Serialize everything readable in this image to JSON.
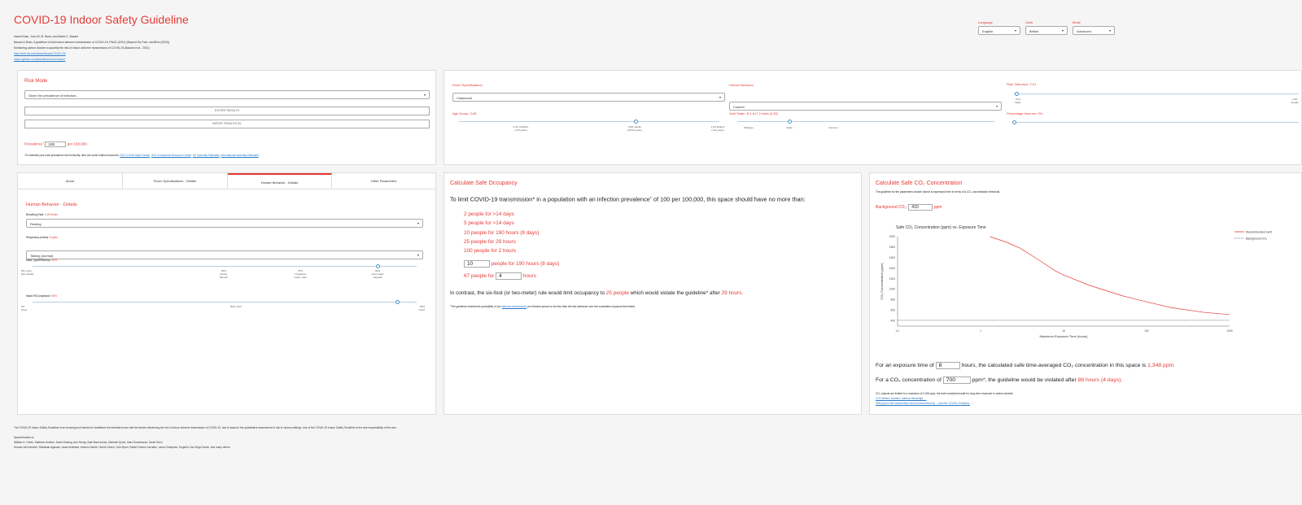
{
  "app": {
    "title": "COVID-19 Indoor Safety Guideline",
    "authors": "Kasim Khan, John W. M. Bush, and Martin Z. Bazant",
    "ref1": "Bazant & Bush, A guideline to limit indoor airborne transmission of COVID-19, PNAS (2021) (Beyond Six Feet, medRxiv (2020))",
    "ref2": "Monitoring carbon dioxide to quantify the risk of indoor airborne transmission of COVID-19 (Bazant et al., 2021)",
    "link1": "http://web.mit.edu/bazant/www/COVID-19/",
    "link2": "https://github.com/kasimkhan/covid-indoor"
  },
  "top_selects": {
    "language": {
      "label": "Language",
      "value": "English"
    },
    "units": {
      "label": "Units",
      "value": "British"
    },
    "mode": {
      "label": "Mode",
      "value": "Advanced"
    }
  },
  "risk_mode": {
    "heading": "Risk Mode",
    "select_value": "Given the prevalence of infection...",
    "export_label": "EXPORT RESULTS",
    "import_label": "IMPORT FROM EXCEL",
    "prevalence_label": "Prevalence",
    "prevalence_value": "100",
    "prevalence_unit": "per 100,000",
    "footnote_prefix": "¹To estimate your local prevalence and immunity, here are some helpful resources:",
    "resources": [
      "CDC COVID Data Tracker",
      "JHU Coronavirus Resource Center",
      "US Immunity Estimates",
      "International Immunity Estimates"
    ]
  },
  "settings": {
    "room_label": "Room Specifications:",
    "room_value": "Classroom",
    "behavior_label": "Human Behavior:",
    "behavior_value": "Custom",
    "risk_label": "Risk Tolerance: 0.01",
    "risk_marks": [
      "0.01\nSafer",
      "1.00\nUnsafe"
    ],
    "risk_level": 0.01,
    "age_label": "Age Group: 0.68",
    "age_marks": [
      "0.23: Children\n(<15 years)",
      "0.68: Adults\n(15-64 years)",
      "1.00: Elderly\n(>64 years)"
    ],
    "age_level": 0.68,
    "strain_label": "Viral Strain: B.1.617.2 India (2.50)",
    "strain_marks": [
      "Wildtype",
      "Delta",
      "Omicron"
    ],
    "immune_label": "Percentage Immune: 0%",
    "immune_level": 0
  },
  "tabs": [
    "About",
    "Room Specifications - Details",
    "Human Behavior - Details",
    "Other Parameters"
  ],
  "behavior_details": {
    "heading": "Human Behavior - Details",
    "breathing_label": "Breathing Rate:",
    "breathing_value": "0.29 ft³/min",
    "breathing_select": "Resting",
    "resp_label": "Respiratory Activity:",
    "resp_value": "5 (q/ft³)",
    "resp_select": "Talking (normal)",
    "mask_label": "Mask Type/Efficiency:",
    "mask_value": "90%",
    "mask_marks": [
      "0% (none,\nface shield)",
      "50%\n(cotton,\nflannel)",
      "75%\n(3-layered\ncotton, silk)",
      "90%\n(chg mask/\nsurgical)"
    ],
    "mask_level": 0.9,
    "fit_label": "Mask Fit/Compliance:",
    "fit_value": "95%",
    "fit_marks": [
      "0%\nNone",
      "50%: Poor",
      "95%\nGood"
    ],
    "fit_level": 0.95
  },
  "occupancy": {
    "heading": "Calculate Safe Occupancy",
    "intro_a": "To limit COVID-19 transmission* in a population with an infection prevalence",
    "intro_b": " of 100 per 100,000, this space should have no more than:",
    "lines": [
      "2 people for >14 days",
      "5 people for >14 days",
      "10 people for 190 hours (8 days)",
      "25 people for 29 hours",
      "100 people for 2 hours"
    ],
    "custom_people": "10",
    "custom_people_suffix": "people for 190 hours (8 days)",
    "custom_hours_prefix": "67 people for",
    "custom_hours": "4",
    "custom_hours_suffix": "hours",
    "contrast_a": "In contrast, the six-foot (or two-meter) rule would limit occupancy to ",
    "contrast_people": "25 people",
    "contrast_b": " which would violate the guideline* after ",
    "contrast_hours": "29 hours.",
    "note_a": "*The guideline restricts the probability of one ",
    "note_link": "airborne transmission",
    "note_b": " per infected person to be less than the risk tolerance over the cumulative exposure time listed."
  },
  "co2": {
    "heading": "Calculate Safe CO₂ Concentration",
    "sub": "The guideline for the parameters chosen above is expressed here in terms of a CO₂ concentration threshold.",
    "bg_label": "Background CO₂:",
    "bg_value": "410",
    "bg_unit": "ppm",
    "exp_a": "For an exposure time of",
    "exp_val": "8",
    "exp_b": "hours, the calculated safe time-averaged CO₂ concentration in this space is",
    "exp_result": "1,348 ppm.",
    "conc_a": "For a CO₂ concentration of",
    "conc_val": "700",
    "conc_b": "ppm*, the guideline would be violated after",
    "conc_result": "88 hours (4 days).",
    "note1": "CO₂ outputs are limited to a maximum of 2,000 ppm, the level considered safe for long-term exposure to carbon dioxide.",
    "note2": "CO2 Meters: Aranet4, Kaiterra Sensedge, ...",
    "note3": "*800 ppm is the conservative limit recommended by ... (see the COVID-19 tables)."
  },
  "footer": {
    "line1": "The COVID-19 Indoor Safety Guideline is an evolving tool intended to familiarize the interested user with the factors influencing the risk of indoor airborne transmission of COVID-19, and to assist in the quantitative assessment of risk in various settings. Use of the COVID-19 Indoor Safety Guideline is the sole responsibility of the user.",
    "thanks_title": "Special thanks to:",
    "thanks1": "William H. Green, Matthew Hoefner, David Keating, Ann Kinzig, Gadi MacLennan, Michelle Quinn, Marc Rosenbaum, David Stern",
    "thanks2": "Horacio Abi Darwish, Shadarah Agarwal, Jonas Arbeláez, Antonio Dantié, Henrik Gesch, John Byon, Rafael Guerra Carvalho, Laura Champion, Eugenio Cao Vega Durner, and many others"
  },
  "chart_data": {
    "type": "line",
    "title": "Safe CO₂ Concentration (ppm) vs. Exposure Time",
    "xlabel": "Maximum Exposure Time (hours)",
    "ylabel": "CO₂ Concentration (ppm)",
    "xscale": "log",
    "xlim": [
      0.1,
      1000
    ],
    "ylim": [
      300,
      2000
    ],
    "x_ticks": [
      "0.1",
      "1",
      "10",
      "100",
      "1000"
    ],
    "y_ticks": [
      "400",
      "600",
      "800",
      "1000",
      "1200",
      "1400",
      "1600",
      "1800",
      "2000"
    ],
    "legend_position": "right",
    "series": [
      {
        "name": "Recommended Limit",
        "color": "#e53935",
        "style": "solid",
        "x": [
          1.3,
          2,
          3,
          5,
          8,
          10,
          20,
          50,
          100,
          200,
          500,
          1000
        ],
        "y": [
          2000,
          1900,
          1780,
          1560,
          1348,
          1270,
          1080,
          880,
          760,
          650,
          560,
          520
        ]
      },
      {
        "name": "Background CO₂",
        "color": "#555555",
        "style": "dotted",
        "x": [
          0.1,
          1000
        ],
        "y": [
          410,
          410
        ]
      }
    ]
  }
}
